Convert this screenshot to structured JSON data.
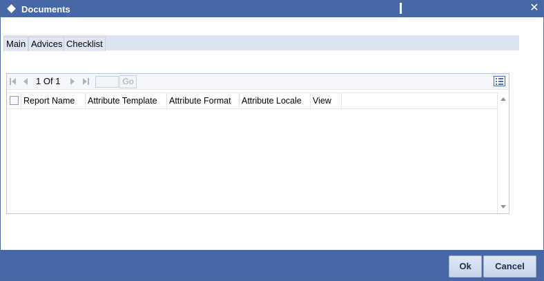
{
  "window": {
    "title": "Documents",
    "close_icon": "close-icon"
  },
  "tabs": [
    {
      "label": "Main"
    },
    {
      "label": "Advices"
    },
    {
      "label": "Checklist"
    }
  ],
  "grid": {
    "pagination": {
      "current_page": "1",
      "of_label": "Of",
      "total_pages": "1",
      "go_label": "Go"
    },
    "columns": [
      "Report Name",
      "Attribute Template",
      "Attribute Format",
      "Attribute Locale",
      "View"
    ],
    "rows": []
  },
  "footer": {
    "ok_label": "Ok",
    "cancel_label": "Cancel"
  },
  "colors": {
    "titlebar": "#4767a6",
    "tab_bg": "#dde4f1",
    "button_bg": "#dfe7f3"
  }
}
